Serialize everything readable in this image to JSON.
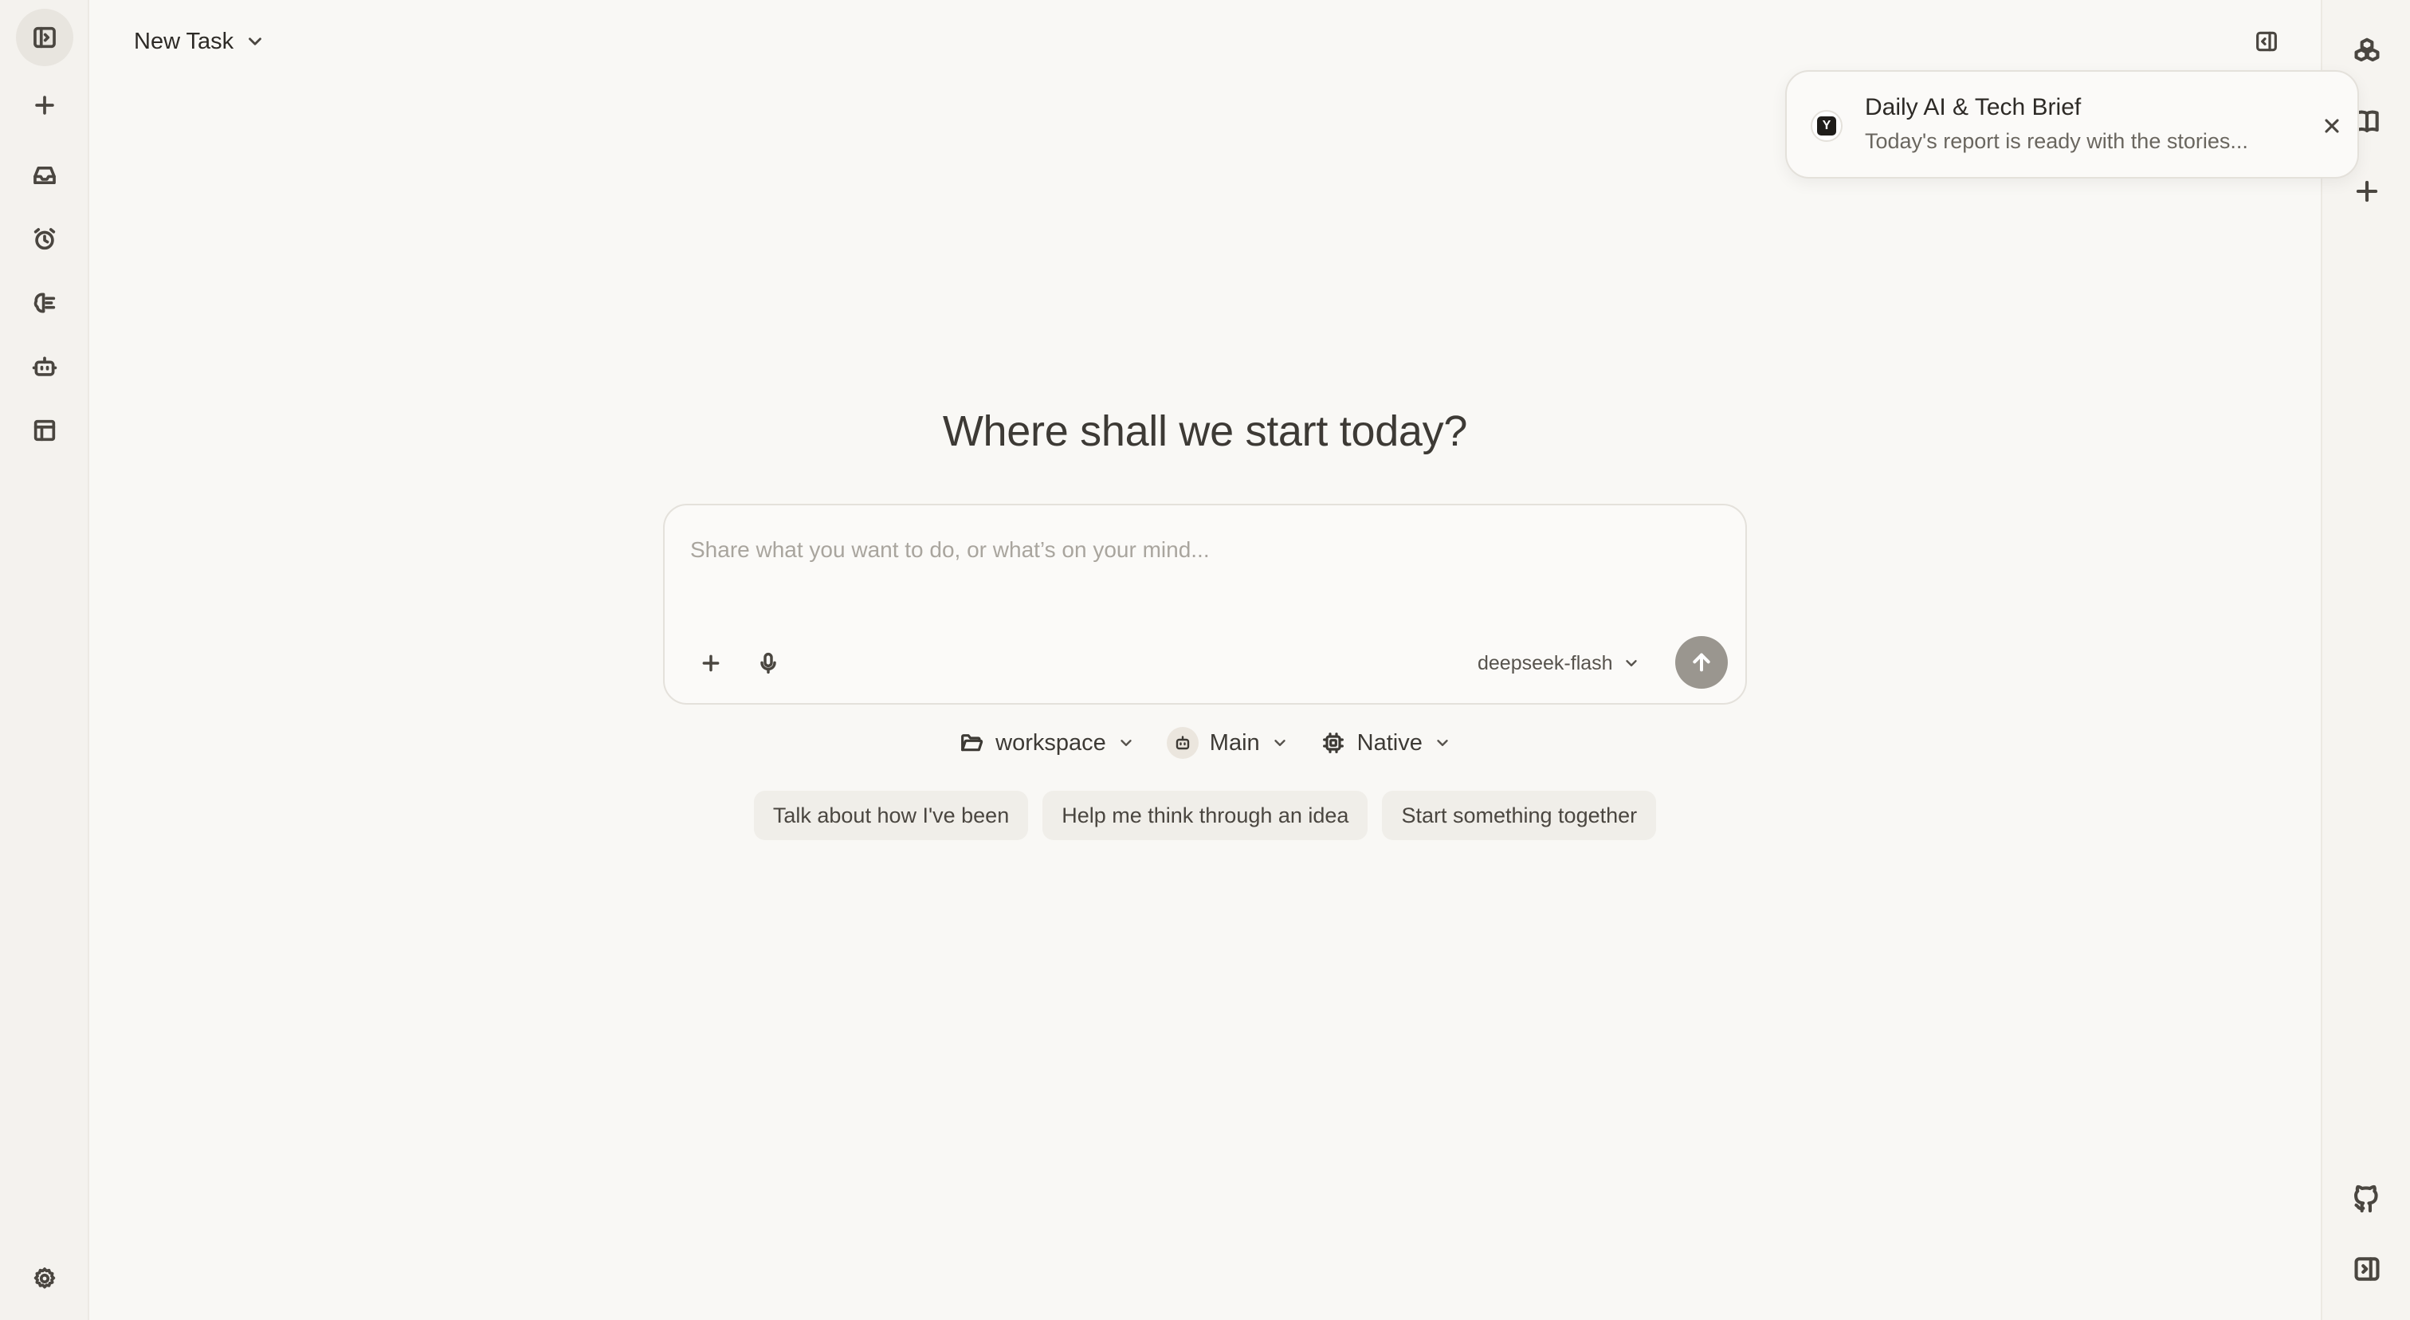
{
  "header": {
    "title": "New Task"
  },
  "left_rail": {
    "items": [
      {
        "icon": "sidebar-toggle-icon"
      },
      {
        "icon": "plus-icon"
      },
      {
        "icon": "inbox-icon"
      },
      {
        "icon": "alarm-clock-icon"
      },
      {
        "icon": "brain-icon"
      },
      {
        "icon": "bot-icon"
      },
      {
        "icon": "layout-icon"
      },
      {
        "icon": "gear-icon"
      }
    ]
  },
  "right_rail": {
    "items": [
      {
        "icon": "cubes-icon"
      },
      {
        "icon": "book-icon"
      },
      {
        "icon": "plus-icon"
      },
      {
        "icon": "github-icon"
      },
      {
        "icon": "panel-right-icon"
      }
    ]
  },
  "notification": {
    "title": "Daily AI & Tech Brief",
    "body": "Today's report is ready with the stories...",
    "logo_letter": "Y"
  },
  "hero": {
    "title": "Where shall we start today?"
  },
  "composer": {
    "placeholder": "Share what you want to do, or what’s on your mind...",
    "value": "",
    "model": "deepseek-flash"
  },
  "options": {
    "workspace": "workspace",
    "agent": "Main",
    "runtime": "Native"
  },
  "suggestions": [
    "Talk about how I've been",
    "Help me think through an idea",
    "Start something together"
  ],
  "colors": {
    "background": "#f9f8f5",
    "rail": "#f4f2ee",
    "send_button": "#9a968f",
    "chip": "#f0eee9"
  }
}
